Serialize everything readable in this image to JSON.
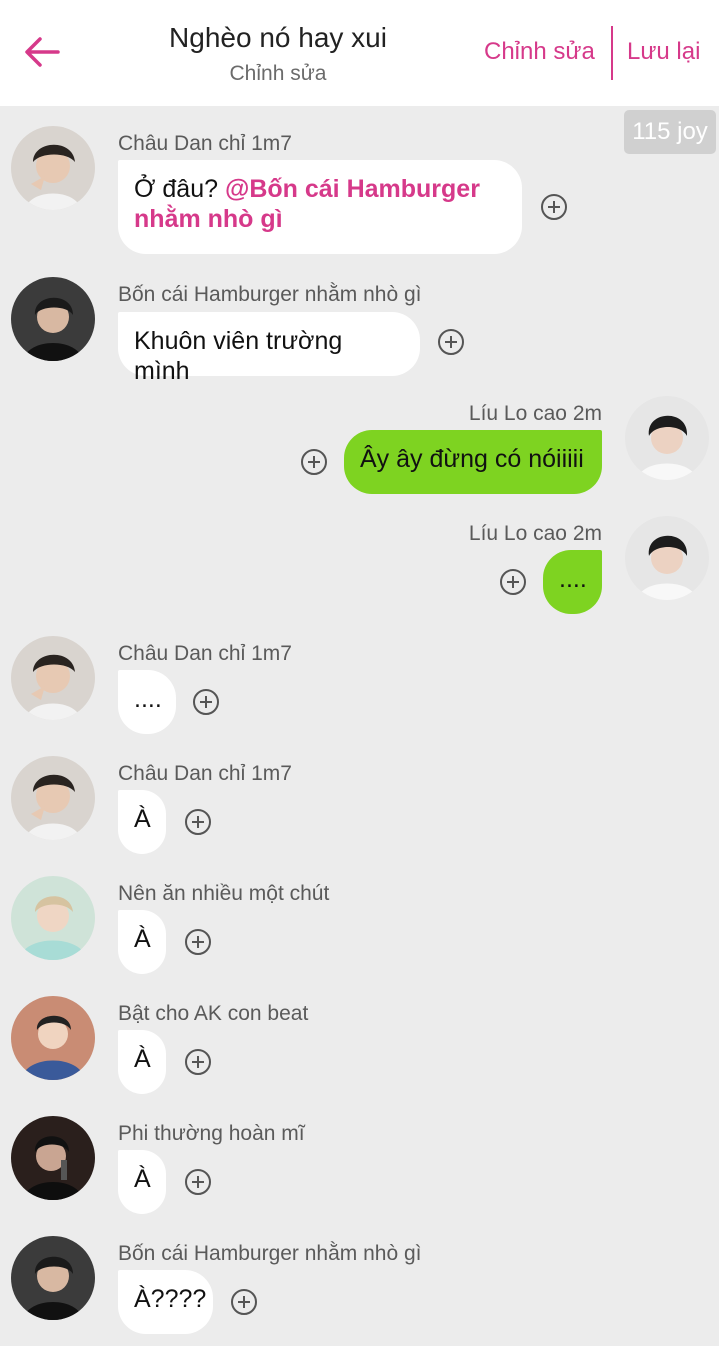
{
  "header": {
    "title": "Nghèo nó hay xui",
    "subtitle": "Chỉnh sửa",
    "edit_label": "Chỉnh sửa",
    "save_label": "Lưu lại"
  },
  "joy_badge": "115 joy",
  "colors": {
    "accent": "#d6398a",
    "sent_bubble": "#7ed321",
    "received_bubble": "#ffffff",
    "background": "#ececec"
  },
  "messages": [
    {
      "sender": "Châu Dan chỉ 1m7",
      "text_plain": "Ở đâu? ",
      "mention": "@Bốn cái Hamburger nhằm nhò gì",
      "side": "left"
    },
    {
      "sender": "Bốn cái Hamburger nhằm nhò gì",
      "text": "Khuôn viên trường mình",
      "side": "left"
    },
    {
      "sender": "Líu Lo cao 2m",
      "text": "Ây ây đừng có nóiiiii",
      "side": "right"
    },
    {
      "sender": "Líu Lo cao 2m",
      "text": "....",
      "side": "right"
    },
    {
      "sender": "Châu Dan chỉ 1m7",
      "text": "....",
      "side": "left"
    },
    {
      "sender": "Châu Dan chỉ 1m7",
      "text": "À",
      "side": "left"
    },
    {
      "sender": "Nên ăn nhiều một chút",
      "text": "À",
      "side": "left"
    },
    {
      "sender": "Bật cho AK con beat",
      "text": "À",
      "side": "left"
    },
    {
      "sender": "Phi thường hoàn mĩ",
      "text": "À",
      "side": "left"
    },
    {
      "sender": "Bốn cái Hamburger nhằm nhò gì",
      "text": "À????",
      "side": "left"
    }
  ]
}
